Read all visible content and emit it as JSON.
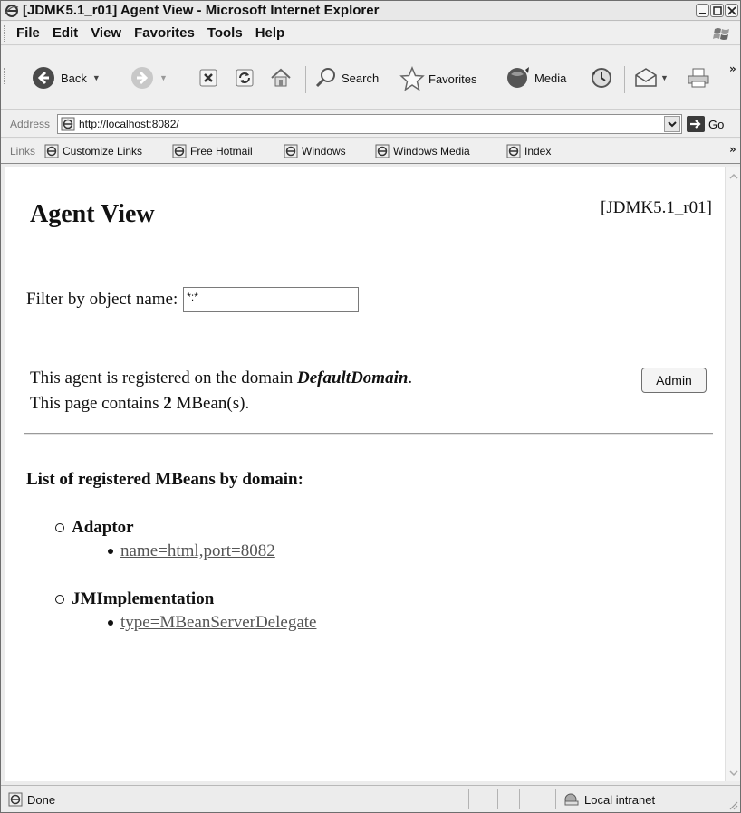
{
  "window": {
    "title": "[JDMK5.1_r01] Agent View - Microsoft Internet Explorer"
  },
  "menu": {
    "items": [
      "File",
      "Edit",
      "View",
      "Favorites",
      "Tools",
      "Help"
    ]
  },
  "toolbar": {
    "back_label": "Back",
    "search_label": "Search",
    "favorites_label": "Favorites",
    "media_label": "Media"
  },
  "address": {
    "label": "Address",
    "value": "http://localhost:8082/",
    "go_label": "Go"
  },
  "links": {
    "label": "Links",
    "items": [
      "Customize Links",
      "Free Hotmail",
      "Windows",
      "Windows Media",
      "Index"
    ]
  },
  "page": {
    "heading": "Agent View",
    "version": "[JDMK5.1_r01]",
    "filter_label": "Filter by object name:",
    "filter_value": "*:*",
    "domain_prefix": "This agent is registered on the domain ",
    "domain_name": "DefaultDomain",
    "domain_suffix": ".",
    "count_prefix": "This page contains ",
    "count_value": "2",
    "count_suffix": " MBean(s).",
    "admin_label": "Admin",
    "list_title": "List of registered MBeans by domain:",
    "domains": [
      {
        "name": "Adaptor",
        "mbeans": [
          "name=html,port=8082"
        ]
      },
      {
        "name": "JMImplementation",
        "mbeans": [
          "type=MBeanServerDelegate"
        ]
      }
    ]
  },
  "status": {
    "text": "Done",
    "zone": "Local intranet"
  },
  "colors": {
    "chrome": "#efefef",
    "link": "#555555"
  }
}
